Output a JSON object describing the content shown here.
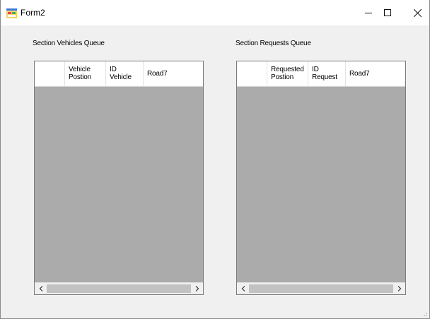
{
  "window": {
    "title": "Form2",
    "icon": "winforms-app-icon",
    "controls": [
      "minimize-icon",
      "maximize-icon",
      "close-icon"
    ]
  },
  "vehicles": {
    "label": "Section Vehicles Queue",
    "columns": [
      {
        "line1": "Vehicle",
        "line2": "Postion"
      },
      {
        "line1": "ID",
        "line2": "Vehicle"
      },
      {
        "line1": "Road7",
        "line2": ""
      }
    ],
    "rows": []
  },
  "requests": {
    "label": "Section Requests Queue",
    "columns": [
      {
        "line1": "Requested",
        "line2": "Postion"
      },
      {
        "line1": "ID",
        "line2": "Request"
      },
      {
        "line1": "Road7",
        "line2": ""
      }
    ],
    "rows": []
  },
  "colors": {
    "grid_background": "#ababab",
    "window_background": "#f0f0f0",
    "titlebar": "#ffffff"
  }
}
